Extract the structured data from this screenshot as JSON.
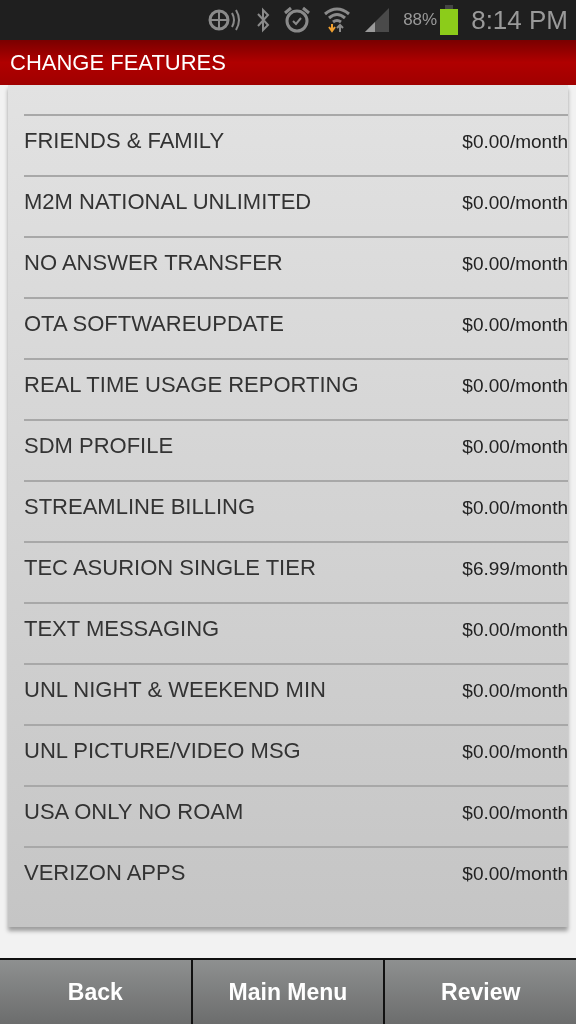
{
  "status_bar": {
    "battery_percent": "88%",
    "time": "8:14 PM"
  },
  "title": "CHANGE FEATURES",
  "features": [
    {
      "name": "FRIENDS & FAMILY",
      "price": "$0.00/month"
    },
    {
      "name": "M2M NATIONAL UNLIMITED",
      "price": "$0.00/month"
    },
    {
      "name": "NO ANSWER TRANSFER",
      "price": "$0.00/month"
    },
    {
      "name": "OTA SOFTWAREUPDATE",
      "price": "$0.00/month"
    },
    {
      "name": "REAL TIME USAGE REPORTING",
      "price": "$0.00/month"
    },
    {
      "name": "SDM PROFILE",
      "price": "$0.00/month"
    },
    {
      "name": "STREAMLINE BILLING",
      "price": "$0.00/month"
    },
    {
      "name": "TEC ASURION SINGLE TIER",
      "price": "$6.99/month"
    },
    {
      "name": "TEXT MESSAGING",
      "price": "$0.00/month"
    },
    {
      "name": "UNL NIGHT & WEEKEND MIN",
      "price": "$0.00/month"
    },
    {
      "name": "UNL PICTURE/VIDEO MSG",
      "price": "$0.00/month"
    },
    {
      "name": "USA ONLY NO ROAM",
      "price": "$0.00/month"
    },
    {
      "name": "VERIZON APPS",
      "price": "$0.00/month"
    }
  ],
  "buttons": [
    "Back",
    "Main Menu",
    "Review"
  ]
}
